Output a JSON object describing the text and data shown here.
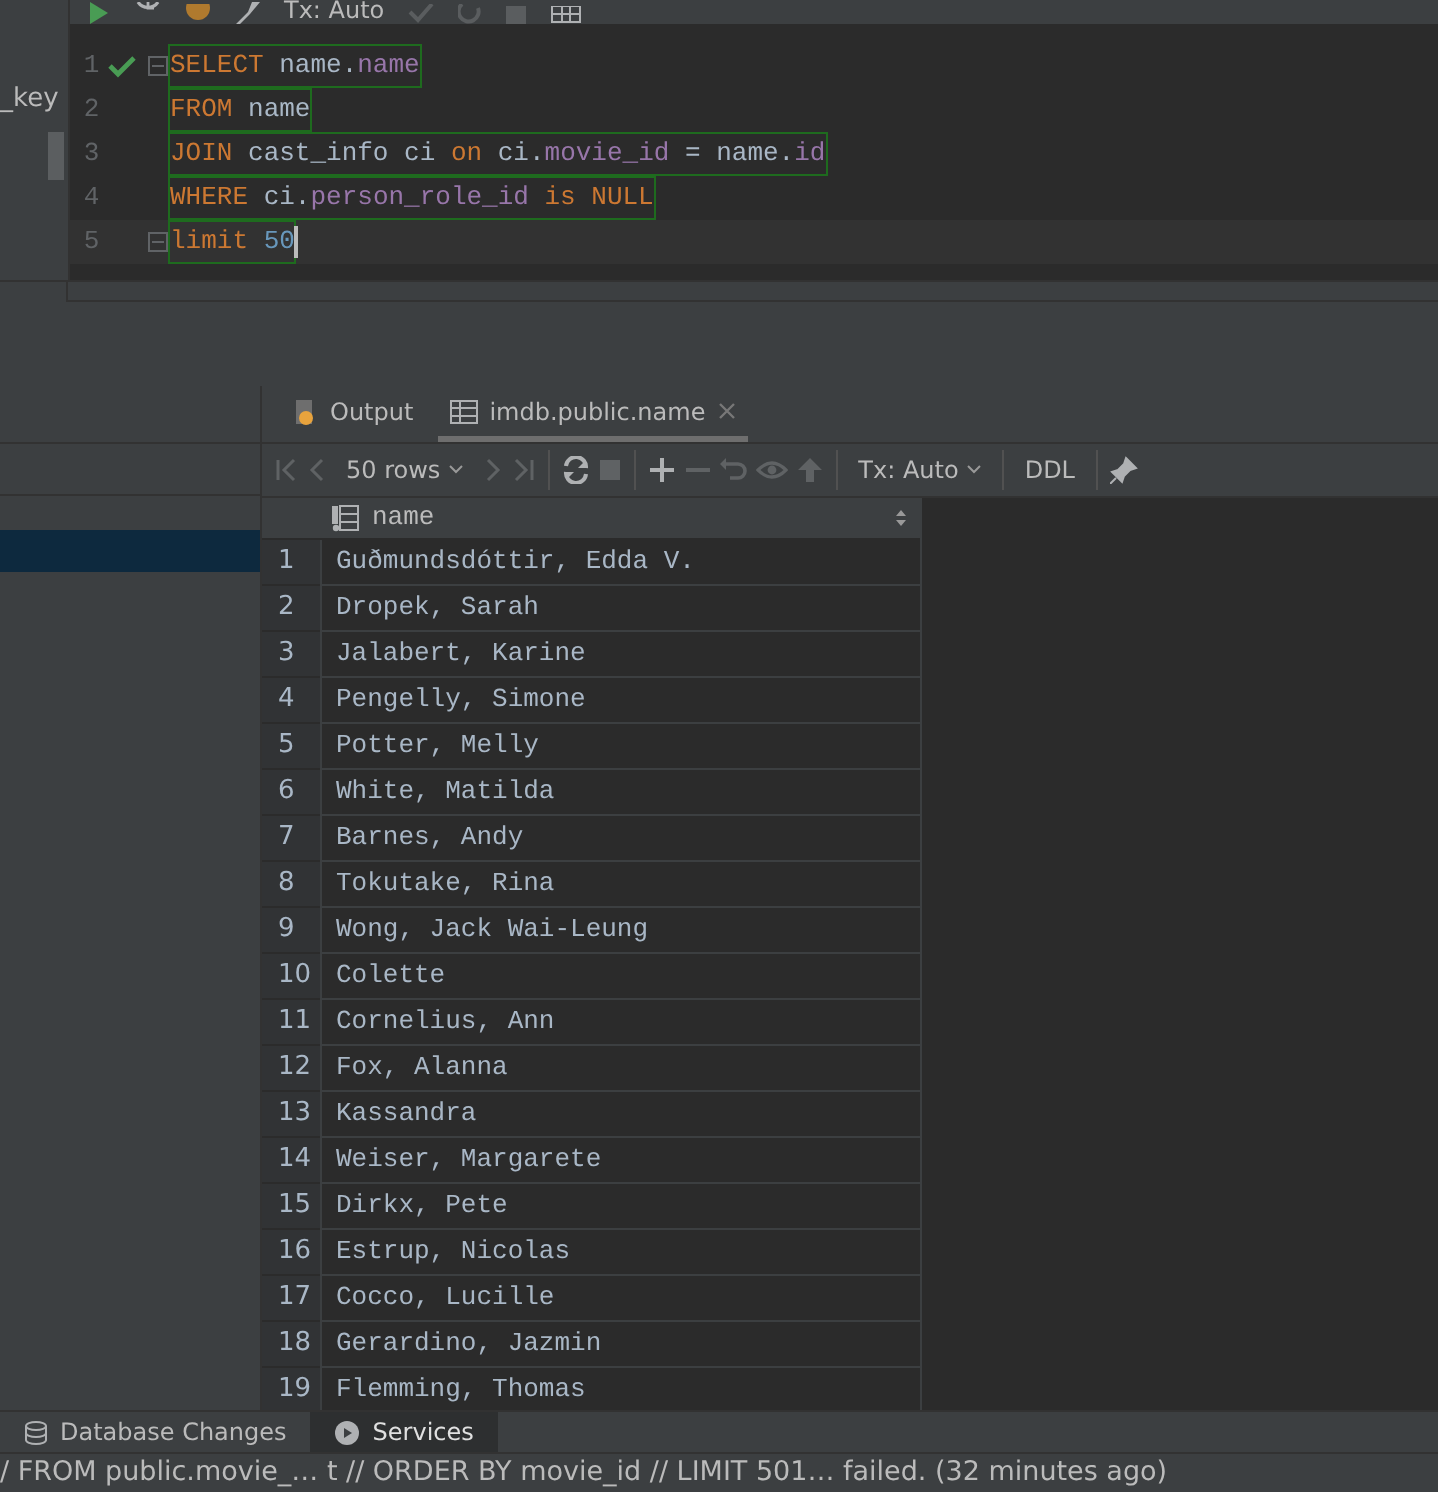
{
  "top_toolbar": {
    "tx_mode": "Tx: Auto"
  },
  "left_panel": {
    "label": "_key"
  },
  "editor": {
    "lines": [
      {
        "number": "1",
        "executed": true,
        "fold": true,
        "current": false,
        "tokens": [
          {
            "text": "SELECT",
            "kind": "keyword"
          },
          {
            "text": " name.",
            "kind": "ident"
          },
          {
            "text": "name",
            "kind": "field"
          }
        ]
      },
      {
        "number": "2",
        "executed": false,
        "fold": false,
        "current": false,
        "tokens": [
          {
            "text": "FROM",
            "kind": "keyword"
          },
          {
            "text": " name",
            "kind": "ident"
          }
        ]
      },
      {
        "number": "3",
        "executed": false,
        "fold": false,
        "current": false,
        "tokens": [
          {
            "text": "JOIN",
            "kind": "keyword"
          },
          {
            "text": " cast_info ci ",
            "kind": "ident"
          },
          {
            "text": "on",
            "kind": "keyword"
          },
          {
            "text": " ci.",
            "kind": "ident"
          },
          {
            "text": "movie_id",
            "kind": "field"
          },
          {
            "text": " = name.",
            "kind": "ident"
          },
          {
            "text": "id",
            "kind": "field"
          }
        ]
      },
      {
        "number": "4",
        "executed": false,
        "fold": false,
        "current": false,
        "tokens": [
          {
            "text": "WHERE",
            "kind": "keyword"
          },
          {
            "text": " ci.",
            "kind": "ident"
          },
          {
            "text": "person_role_id",
            "kind": "field"
          },
          {
            "text": " is NULL",
            "kind": "keyword"
          }
        ]
      },
      {
        "number": "5",
        "executed": false,
        "fold": true,
        "current": true,
        "tokens": [
          {
            "text": "limit",
            "kind": "keyword"
          },
          {
            "text": " 50",
            "kind": "number"
          }
        ]
      }
    ]
  },
  "results": {
    "tabs": [
      {
        "label": "Output",
        "kind": "output",
        "selected": false
      },
      {
        "label": "imdb.public.name",
        "kind": "table",
        "selected": true
      }
    ],
    "toolbar": {
      "page_size": "50 rows",
      "tx_mode": "Tx: Auto",
      "ddl": "DDL"
    },
    "grid": {
      "columns": [
        "name"
      ],
      "rows": [
        {
          "number": "1",
          "name": "Guðmundsdóttir, Edda V."
        },
        {
          "number": "2",
          "name": "Dropek, Sarah"
        },
        {
          "number": "3",
          "name": "Jalabert, Karine"
        },
        {
          "number": "4",
          "name": "Pengelly, Simone"
        },
        {
          "number": "5",
          "name": "Potter, Melly"
        },
        {
          "number": "6",
          "name": "White, Matilda"
        },
        {
          "number": "7",
          "name": "Barnes, Andy"
        },
        {
          "number": "8",
          "name": "Tokutake, Rina"
        },
        {
          "number": "9",
          "name": "Wong, Jack Wai-Leung"
        },
        {
          "number": "10",
          "name": "Colette"
        },
        {
          "number": "11",
          "name": "Cornelius, Ann"
        },
        {
          "number": "12",
          "name": "Fox, Alanna"
        },
        {
          "number": "13",
          "name": "Kassandra"
        },
        {
          "number": "14",
          "name": "Weiser, Margarete"
        },
        {
          "number": "15",
          "name": "Dirkx, Pete"
        },
        {
          "number": "16",
          "name": "Estrup, Nicolas"
        },
        {
          "number": "17",
          "name": "Cocco, Lucille"
        },
        {
          "number": "18",
          "name": "Gerardino, Jazmin"
        },
        {
          "number": "19",
          "name": "Flemming, Thomas"
        }
      ]
    }
  },
  "bottom_tabs": [
    {
      "label": "Database Changes",
      "kind": "changes",
      "selected": false
    },
    {
      "label": "Services",
      "kind": "services",
      "selected": true
    }
  ],
  "status_bar": "/ FROM public.movie_… t // ORDER BY movie_id // LIMIT 501… failed. (32 minutes ago)"
}
